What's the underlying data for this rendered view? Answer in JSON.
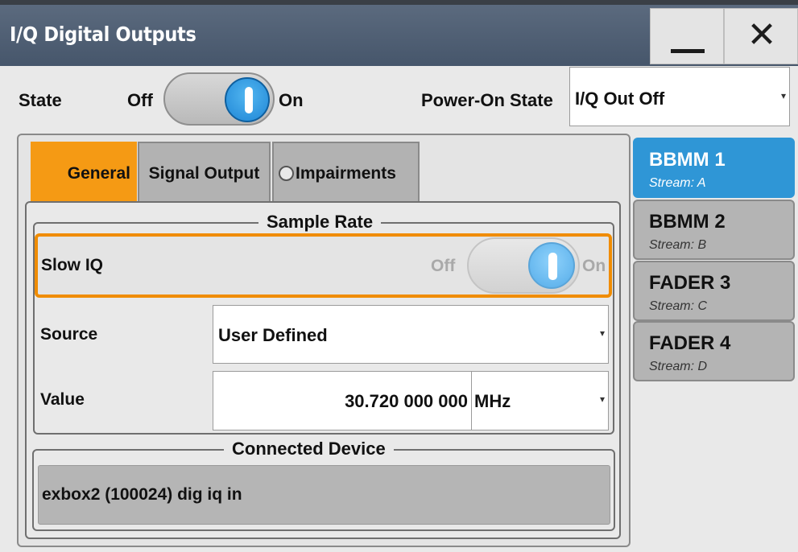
{
  "window": {
    "title": "I/Q Digital Outputs"
  },
  "state": {
    "label": "State",
    "off": "Off",
    "on": "On",
    "value": "On"
  },
  "power_on_state": {
    "label": "Power-On State",
    "value": "I/Q Out Off"
  },
  "tabs": [
    {
      "label": "General",
      "active": true
    },
    {
      "label": "Signal Output",
      "active": false
    },
    {
      "label": "Impairments",
      "active": false
    }
  ],
  "sample_rate": {
    "title": "Sample Rate",
    "slow_iq": {
      "label": "Slow IQ",
      "off": "Off",
      "on": "On",
      "value": "On"
    },
    "source": {
      "label": "Source",
      "value": "User Defined"
    },
    "value": {
      "label": "Value",
      "number": "30.720 000 000",
      "unit": "MHz"
    }
  },
  "connected_device": {
    "title": "Connected Device",
    "value": "exbox2 (100024) dig iq in"
  },
  "streams": [
    {
      "name": "BBMM 1",
      "stream": "Stream: A",
      "active": true
    },
    {
      "name": "BBMM 2",
      "stream": "Stream: B",
      "active": false
    },
    {
      "name": "FADER 3",
      "stream": "Stream: C",
      "active": false
    },
    {
      "name": "FADER 4",
      "stream": "Stream: D",
      "active": false
    }
  ],
  "colors": {
    "accent": "#f59a14",
    "active_stream": "#2f96d6",
    "titlebar": "#4f5e72"
  }
}
